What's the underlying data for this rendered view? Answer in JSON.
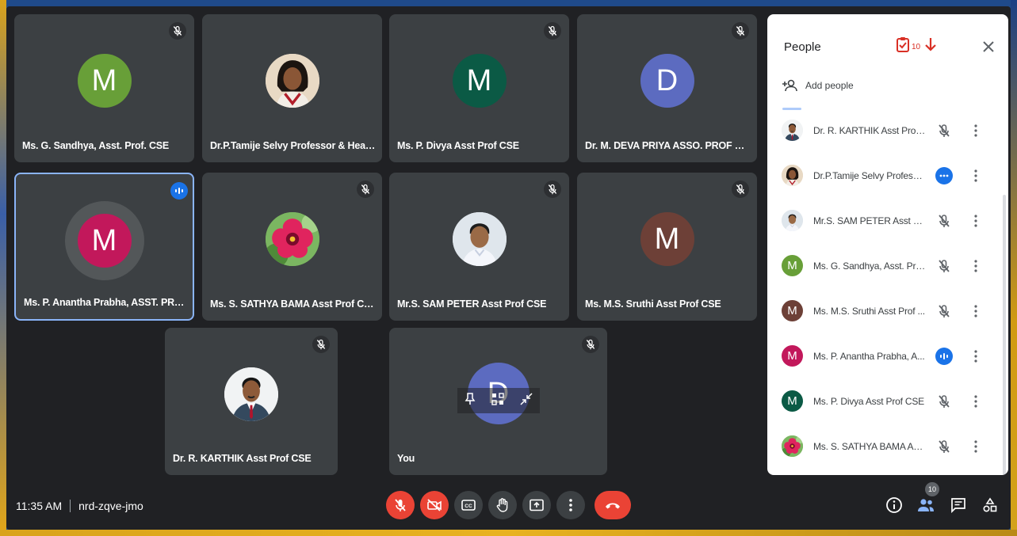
{
  "tiles": [
    {
      "name": "Ms. G. Sandhya, Asst. Prof. CSE",
      "initial": "M",
      "color": "#689f38",
      "kind": "letter",
      "mic": "muted"
    },
    {
      "name": "Dr.P.Tamije Selvy Professor & Head ...",
      "initial": "",
      "color": "#e8d9c4",
      "kind": "woman-photo",
      "mic": "none"
    },
    {
      "name": "Ms. P. Divya Asst Prof CSE",
      "initial": "M",
      "color": "#0b5a45",
      "kind": "letter",
      "mic": "muted"
    },
    {
      "name": "Dr. M. DEVA PRIYA ASSO. PROF CSE",
      "initial": "D",
      "color": "#5c6bc0",
      "kind": "letter",
      "mic": "muted"
    },
    {
      "name": "Ms. P. Anantha Prabha, ASST. PROF",
      "initial": "M",
      "color": "#c2185b",
      "kind": "letter",
      "mic": "speaking"
    },
    {
      "name": "Ms. S. SATHYA BAMA Asst Prof CSE",
      "initial": "",
      "color": "#6aa84f",
      "kind": "flower-photo",
      "mic": "muted"
    },
    {
      "name": "Mr.S. SAM PETER Asst Prof CSE",
      "initial": "",
      "color": "#dfe6ec",
      "kind": "man-photo",
      "mic": "muted"
    },
    {
      "name": "Ms. M.S. Sruthi Asst Prof CSE",
      "initial": "M",
      "color": "#6d4037",
      "kind": "letter",
      "mic": "muted"
    },
    {
      "name": "Dr. R. KARTHIK Asst Prof CSE",
      "initial": "",
      "color": "#e9ecef",
      "kind": "suit-photo",
      "mic": "muted"
    },
    {
      "name": "You",
      "initial": "D",
      "color": "#5c6bc0",
      "kind": "self",
      "mic": "muted"
    }
  ],
  "panel": {
    "title": "People",
    "count": "10",
    "add_people": "Add people",
    "participants": [
      {
        "name": "Dr. R. KARTHIK Asst Prof ...",
        "initial": "",
        "color": "#e9ecef",
        "kind": "suit-photo",
        "mic": "muted"
      },
      {
        "name": "Dr.P.Tamije Selvy Professo...",
        "initial": "",
        "color": "#e8d9c4",
        "kind": "woman-photo",
        "mic": "dots"
      },
      {
        "name": "Mr.S. SAM PETER Asst Pro...",
        "initial": "",
        "color": "#dfe6ec",
        "kind": "man-photo",
        "mic": "muted"
      },
      {
        "name": "Ms. G. Sandhya, Asst. Pro...",
        "initial": "M",
        "color": "#689f38",
        "kind": "letter",
        "mic": "muted"
      },
      {
        "name": "Ms. M.S. Sruthi Asst Prof ...",
        "initial": "M",
        "color": "#6d4037",
        "kind": "letter",
        "mic": "muted"
      },
      {
        "name": "Ms. P. Anantha Prabha, A...",
        "initial": "M",
        "color": "#c2185b",
        "kind": "letter",
        "mic": "speaking"
      },
      {
        "name": "Ms. P. Divya Asst Prof CSE",
        "initial": "M",
        "color": "#0b5a45",
        "kind": "letter",
        "mic": "muted"
      },
      {
        "name": "Ms. S. SATHYA BAMA Ass...",
        "initial": "",
        "color": "#6aa84f",
        "kind": "flower-photo",
        "mic": "muted"
      }
    ]
  },
  "bottom": {
    "time": "11:35 AM",
    "meeting_code": "nrd-zqve-jmo",
    "people_badge": "10"
  },
  "colors": {
    "accent": "#1a73e8",
    "danger": "#ea4335",
    "tile_bg": "#3c4043",
    "app_bg": "#202124"
  },
  "icons": {
    "mute": "mic-off-icon",
    "camera": "videocam-off-icon",
    "captions": "closed-caption-icon",
    "hand": "raise-hand-icon",
    "present": "present-screen-icon",
    "more": "more-vert-icon",
    "hangup": "call-end-icon",
    "info": "info-icon",
    "people": "people-icon",
    "chat": "chat-icon",
    "activities": "activities-icon"
  }
}
